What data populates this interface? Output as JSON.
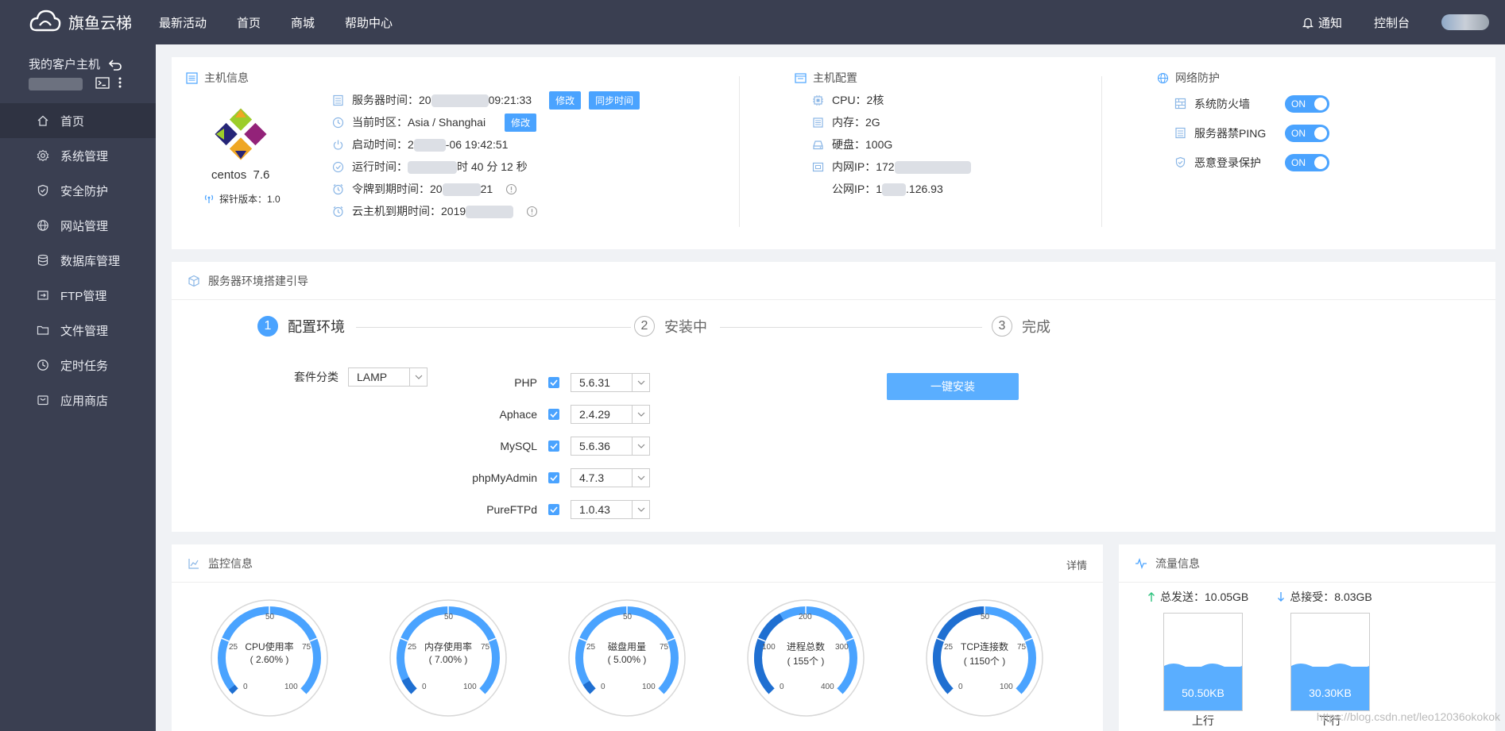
{
  "brand": {
    "name": "旗鱼云梯"
  },
  "nav": [
    "最新活动",
    "首页",
    "商城",
    "帮助中心"
  ],
  "top_right": {
    "notify": "通知",
    "console": "控制台"
  },
  "sidebar": {
    "host_title": "我的客户主机",
    "items": [
      {
        "label": "首页",
        "icon": "home-icon"
      },
      {
        "label": "系统管理",
        "icon": "gear-icon"
      },
      {
        "label": "安全防护",
        "icon": "shield-icon"
      },
      {
        "label": "网站管理",
        "icon": "globe-icon"
      },
      {
        "label": "数据库管理",
        "icon": "database-icon"
      },
      {
        "label": "FTP管理",
        "icon": "ftp-icon"
      },
      {
        "label": "文件管理",
        "icon": "folder-icon"
      },
      {
        "label": "定时任务",
        "icon": "clock-icon"
      },
      {
        "label": "应用商店",
        "icon": "store-icon"
      }
    ]
  },
  "host_info": {
    "title": "主机信息",
    "os_name": "centos  7.6",
    "probe_version": "探针版本：1.0",
    "server_time_label": "服务器时间：20",
    "server_time_tail": "09:21:33",
    "modify": "修改",
    "sync_time": "同步时间",
    "timezone": "当前时区：Asia / Shanghai",
    "boot_time_label": "启动时间：2",
    "boot_time_tail": "-06 19:42:51",
    "uptime_label": "运行时间：",
    "uptime_tail": "时 40 分 12 秒",
    "token_expire_label": "令牌到期时间：20",
    "token_expire_tail": "21",
    "host_expire_label": "云主机到期时间：2019"
  },
  "host_config": {
    "title": "主机配置",
    "cpu": "CPU：2核",
    "memory": "内存：2G",
    "disk": "硬盘：100G",
    "private_ip": "内网IP：172",
    "public_ip_label": "公网IP：1",
    "public_ip_tail": ".126.93"
  },
  "network": {
    "title": "网络防护",
    "items": [
      {
        "label": "系统防火墙",
        "state": "ON"
      },
      {
        "label": "服务器禁PING",
        "state": "ON"
      },
      {
        "label": "恶意登录保护",
        "state": "ON"
      }
    ]
  },
  "env": {
    "title": "服务器环境搭建引导",
    "steps": [
      {
        "num": "1",
        "label": "配置环境"
      },
      {
        "num": "2",
        "label": "安装中"
      },
      {
        "num": "3",
        "label": "完成"
      }
    ],
    "suite_label": "套件分类",
    "suite_value": "LAMP",
    "software": [
      {
        "name": "PHP",
        "version": "5.6.31"
      },
      {
        "name": "Aphace",
        "version": "2.4.29"
      },
      {
        "name": "MySQL",
        "version": "5.6.36"
      },
      {
        "name": "phpMyAdmin",
        "version": "4.7.3"
      },
      {
        "name": "PureFTPd",
        "version": "1.0.43"
      }
    ],
    "install_btn": "一键安装"
  },
  "monitor": {
    "title": "监控信息",
    "detail": "详情",
    "gauges": [
      {
        "title": "CPU使用率",
        "value": "( 2.60% )",
        "fraction": 0.026,
        "ticks": [
          "0",
          "25",
          "50",
          "75",
          "100"
        ]
      },
      {
        "title": "内存使用率",
        "value": "( 7.00% )",
        "fraction": 0.07,
        "ticks": [
          "0",
          "25",
          "50",
          "75",
          "100"
        ]
      },
      {
        "title": "磁盘用量",
        "value": "( 5.00% )",
        "fraction": 0.05,
        "ticks": [
          "0",
          "25",
          "50",
          "75",
          "100"
        ]
      },
      {
        "title": "进程总数",
        "value": "( 155个 )",
        "fraction": 0.3875,
        "ticks": [
          "0",
          "100",
          "200",
          "300",
          "400"
        ]
      },
      {
        "title": "TCP连接数",
        "value": "( 1150个 )",
        "fraction": 0.5,
        "ticks": [
          "0",
          "25",
          "50",
          "75",
          "100"
        ]
      }
    ]
  },
  "flow": {
    "title": "流量信息",
    "sent": "总发送：10.05GB",
    "received": "总接受：8.03GB",
    "up_value": "50.50KB",
    "down_value": "30.30KB",
    "up_label": "上行",
    "down_label": "下行"
  },
  "watermark": "https://blog.csdn.net/leo12036okokok",
  "colors": {
    "topbar": "#3a3f51",
    "accent": "#4aa3ff"
  }
}
